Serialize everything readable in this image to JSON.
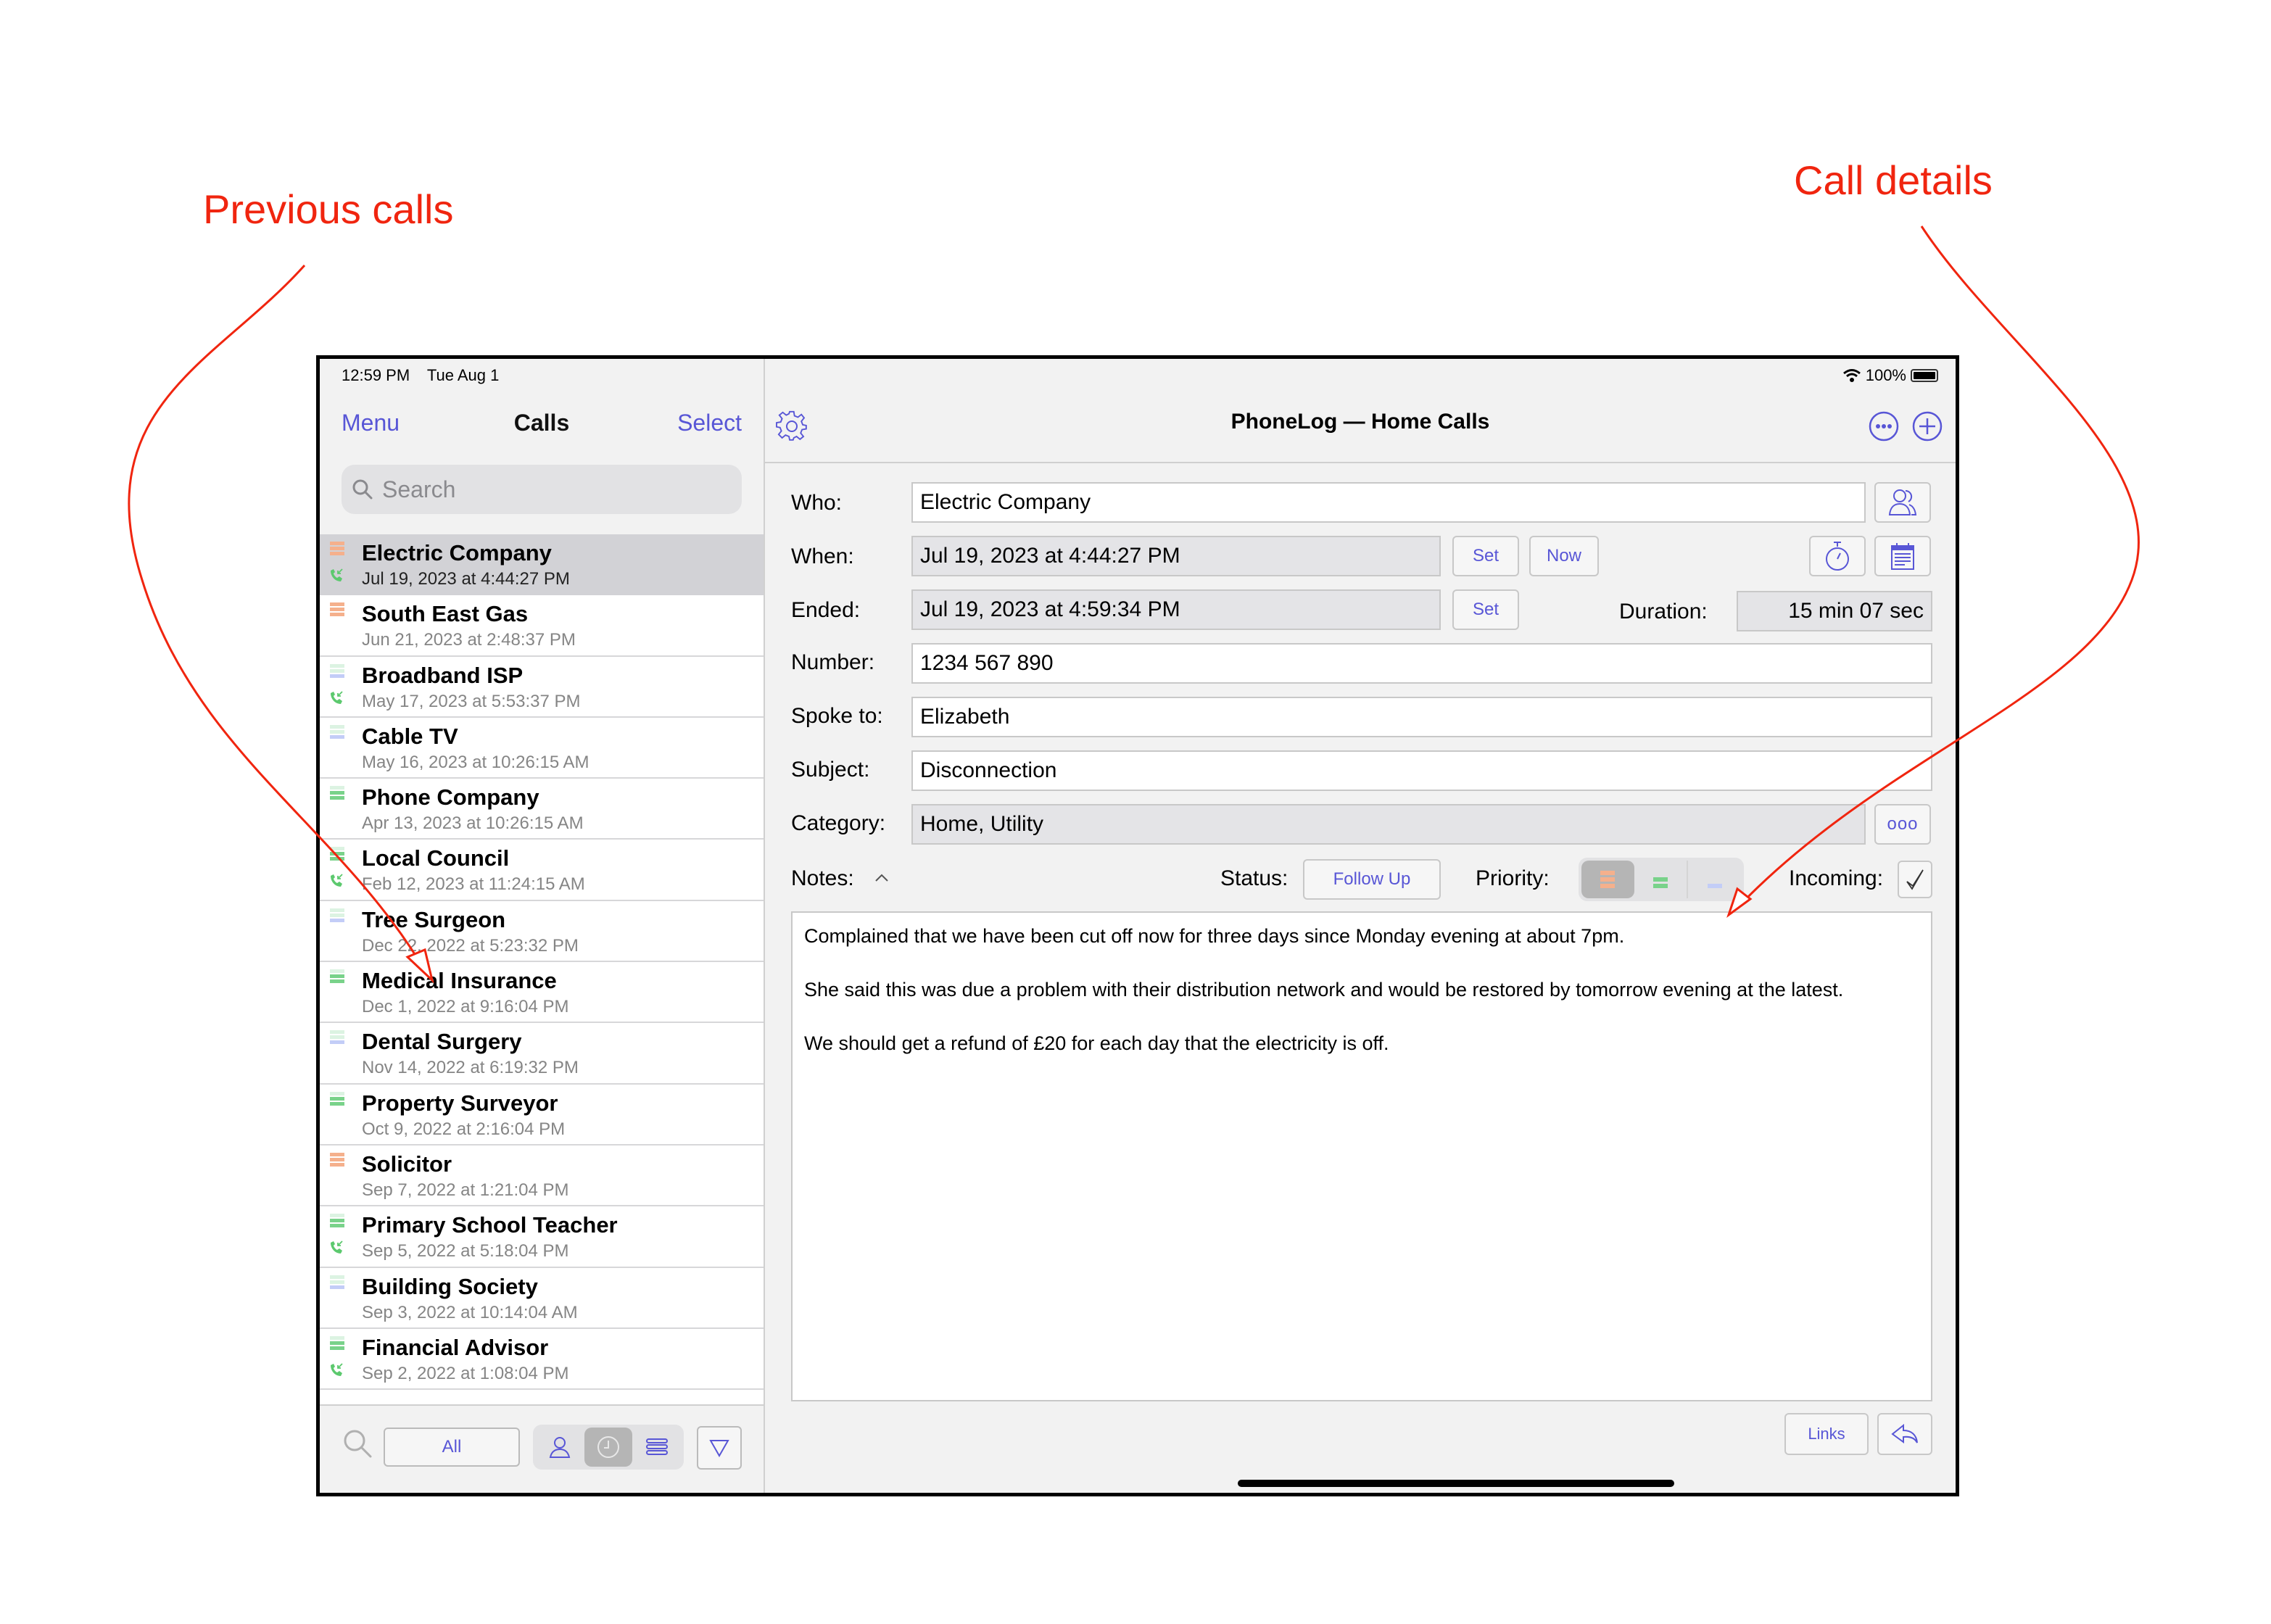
{
  "annotations": {
    "left": "Previous calls",
    "right": "Call details"
  },
  "status_bar": {
    "time": "12:59 PM",
    "date": "Tue Aug 1",
    "battery": "100%"
  },
  "sidebar": {
    "menu_label": "Menu",
    "title": "Calls",
    "select_label": "Select",
    "search_placeholder": "Search",
    "calls": [
      {
        "name": "Electric Company",
        "date": "Jul 19, 2023 at 4:44:27 PM",
        "priority": "high",
        "incoming": true,
        "selected": true
      },
      {
        "name": "South East Gas",
        "date": "Jun 21, 2023 at 2:48:37 PM",
        "priority": "high",
        "incoming": false
      },
      {
        "name": "Broadband ISP",
        "date": "May 17, 2023 at 5:53:37 PM",
        "priority": "low",
        "incoming": true
      },
      {
        "name": "Cable TV",
        "date": "May 16, 2023 at 10:26:15 AM",
        "priority": "low",
        "incoming": false
      },
      {
        "name": "Phone Company",
        "date": "Apr 13, 2023 at 10:26:15 AM",
        "priority": "medium",
        "incoming": false
      },
      {
        "name": "Local Council",
        "date": "Feb 12, 2023 at 11:24:15 AM",
        "priority": "medium",
        "incoming": true
      },
      {
        "name": "Tree Surgeon",
        "date": "Dec 22, 2022 at 5:23:32 PM",
        "priority": "low",
        "incoming": false
      },
      {
        "name": "Medical Insurance",
        "date": "Dec 1, 2022 at 9:16:04 PM",
        "priority": "medium",
        "incoming": false
      },
      {
        "name": "Dental Surgery",
        "date": "Nov 14, 2022 at 6:19:32 PM",
        "priority": "low",
        "incoming": false
      },
      {
        "name": "Property Surveyor",
        "date": "Oct 9, 2022 at 2:16:04 PM",
        "priority": "medium",
        "incoming": false
      },
      {
        "name": "Solicitor",
        "date": "Sep 7, 2022 at 1:21:04 PM",
        "priority": "high",
        "incoming": false
      },
      {
        "name": "Primary School Teacher",
        "date": "Sep 5, 2022 at 5:18:04 PM",
        "priority": "medium",
        "incoming": true
      },
      {
        "name": "Building Society",
        "date": "Sep 3, 2022 at 10:14:04 AM",
        "priority": "low",
        "incoming": false
      },
      {
        "name": "Financial Advisor",
        "date": "Sep 2, 2022 at 1:08:04 PM",
        "priority": "medium",
        "incoming": true
      }
    ],
    "toolbar": {
      "filter_all_label": "All",
      "sort_options": [
        "contact",
        "time",
        "priority"
      ],
      "sort_selected": "time"
    }
  },
  "detail": {
    "title": "PhoneLog — Home Calls",
    "labels": {
      "who": "Who:",
      "when": "When:",
      "ended": "Ended:",
      "duration": "Duration:",
      "number": "Number:",
      "spoke_to": "Spoke to:",
      "subject": "Subject:",
      "category": "Category:",
      "notes": "Notes:",
      "status": "Status:",
      "priority": "Priority:",
      "incoming": "Incoming:"
    },
    "values": {
      "who": "Electric Company",
      "when": "Jul 19, 2023 at 4:44:27 PM",
      "ended": "Jul 19, 2023 at 4:59:34 PM",
      "duration": "15 min 07 sec",
      "number": "1234 567 890",
      "spoke_to": "Elizabeth",
      "subject": "Disconnection",
      "category": "Home, Utility",
      "status": "Follow Up",
      "priority": "high",
      "incoming": true
    },
    "buttons": {
      "set": "Set",
      "now": "Now",
      "category_more": "ooo",
      "links": "Links"
    },
    "notes": [
      "Complained that we have been cut off now for three days since Monday evening at about 7pm.",
      "She said this was due a problem with their distribution network and would be restored by tomorrow evening at the latest.",
      "We should get a refund of £20 for each day that the electricity is off."
    ]
  },
  "colors": {
    "accent": "#5856d6",
    "priority_high": "#f5b08c",
    "priority_medium": "#79d28a",
    "priority_low_green": "#dcf3e2",
    "priority_low_blue": "#c3cdf7",
    "incoming_call": "#5cc96e",
    "annotation": "#f0250f",
    "selected_row": "#d2d2d6"
  }
}
